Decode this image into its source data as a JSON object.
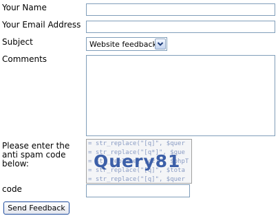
{
  "form": {
    "name_label": "Your Name",
    "name_value": "",
    "email_label": "Your Email Address",
    "email_value": "",
    "subject_label": "Subject",
    "subject_selected": "Website feedback",
    "comments_label": "Comments",
    "comments_value": "",
    "antispam_label_lines": [
      "Please enter the",
      "anti spam code",
      "below:"
    ],
    "captcha": {
      "code_text": "Query81",
      "code_lines": [
        "= str_replace(\"[q]\", $quer",
        "= str_replace(\"[q*]\", $que",
        "= str_replace(\"[cz]\", $phpT",
        "= str_replace(\"[q]\", $tota",
        "= str_replace(\"[q]\", $quer"
      ]
    },
    "code_label": "code",
    "code_value": "",
    "submit_label": "Send Feedback"
  }
}
